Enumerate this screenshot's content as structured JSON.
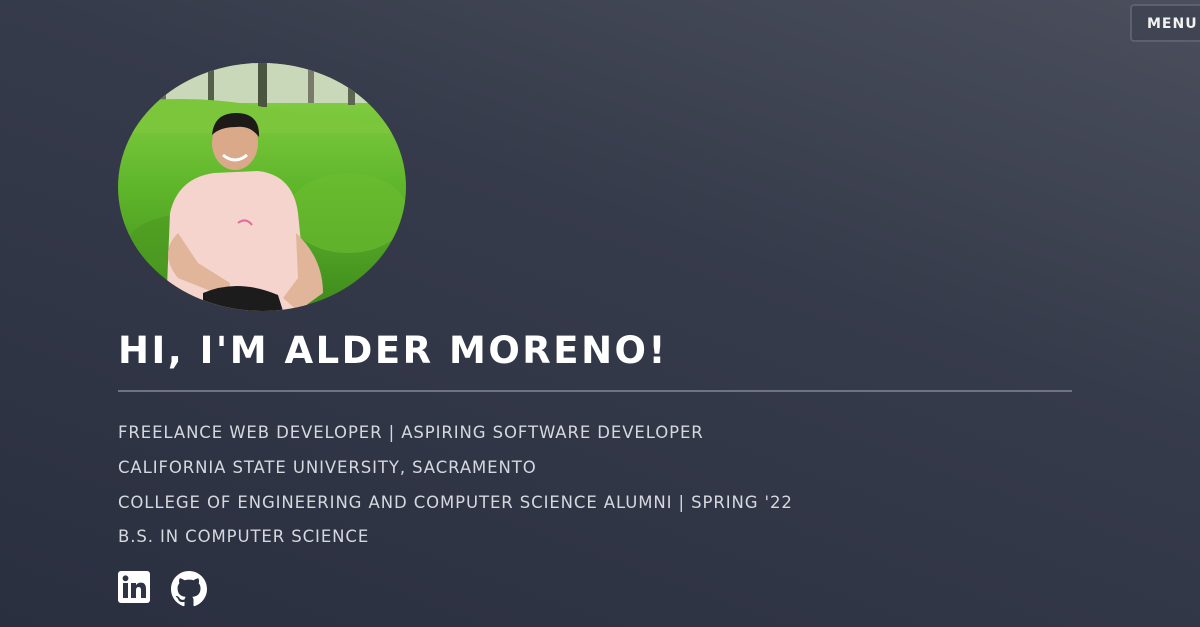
{
  "header": {
    "menu_label": "MENU"
  },
  "profile": {
    "avatar_icon": "profile-photo"
  },
  "hero": {
    "title": "HI, I'M ALDER MORENO!",
    "lines": [
      "FREELANCE WEB DEVELOPER | ASPIRING SOFTWARE DEVELOPER",
      "CALIFORNIA STATE UNIVERSITY, SACRAMENTO",
      "COLLEGE OF ENGINEERING AND COMPUTER SCIENCE ALUMNI | SPRING '22",
      "B.S. IN COMPUTER SCIENCE"
    ]
  },
  "social": {
    "links": [
      {
        "icon": "linkedin-icon"
      },
      {
        "icon": "github-icon"
      }
    ]
  },
  "colors": {
    "background_top": "#4b4f5c",
    "background_bottom": "#2a2f40",
    "title": "#ffffff",
    "text": "#d6d8df",
    "divider": "#6e7382"
  }
}
